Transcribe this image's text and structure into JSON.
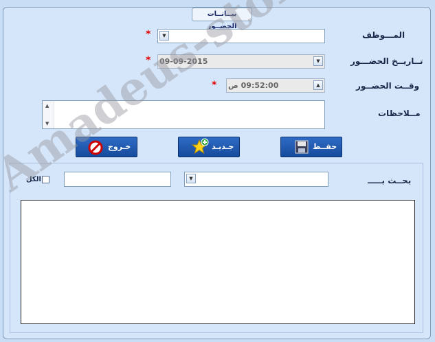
{
  "form": {
    "title": "بيــانــات الحضــور",
    "employee_label": "المـــوظف",
    "date_label": "تــاريــخ الحضـــور",
    "time_label": "وقــت الحضــور",
    "notes_label": "مــلاحظات",
    "required_mark": "*",
    "date_value": "09-09-2015",
    "time_value": "09:52:00 ص",
    "employee_value": "",
    "notes_value": ""
  },
  "buttons": {
    "save": "حفــظ",
    "new": "جـديـد",
    "exit": "خـروج"
  },
  "search": {
    "label": "بحــث بـــــ",
    "all_label": "الكل",
    "field_value": "",
    "text_value": ""
  },
  "watermark": "Amadeus-store.com",
  "icons": {
    "save": "floppy-disk-icon",
    "new": "star-plus-icon",
    "exit": "no-entry-icon",
    "dropdown": "chevron-down-icon"
  }
}
